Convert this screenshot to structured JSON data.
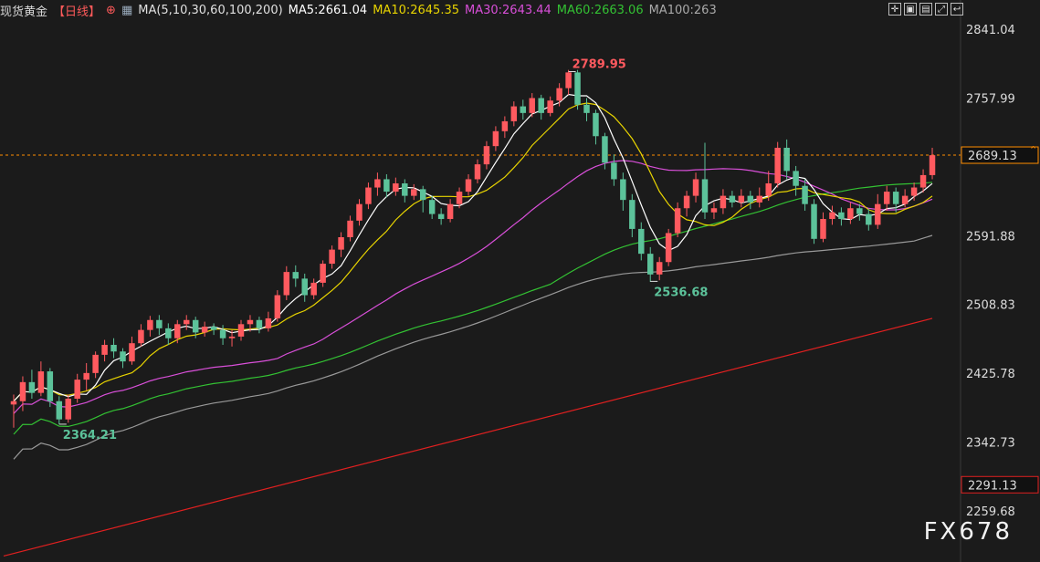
{
  "header": {
    "title": "现货黄金",
    "period": "【日线】",
    "ma_params": "MA(5,10,30,60,100,200)",
    "ma5": "MA5:2661.04",
    "ma10": "MA10:2645.35",
    "ma30": "MA30:2643.44",
    "ma60": "MA60:2663.06",
    "ma100": "MA100:263"
  },
  "watermark": "FX678",
  "colors": {
    "background": "#1b1b1b",
    "up": "#ff5a5f",
    "down": "#5cc29a",
    "ma5": "#ffffff",
    "ma10": "#e8d400",
    "ma30": "#d94fd9",
    "ma60": "#33c233",
    "ma100": "#999999",
    "ma200": "#e02020",
    "price_line": "#ff8c00"
  },
  "chart_data": {
    "type": "candlestick",
    "title": "现货黄金【日线】",
    "y_range": [
      2200,
      2850
    ],
    "y_ticks": [
      2841.04,
      2757.99,
      2591.88,
      2508.83,
      2425.78,
      2342.73,
      2259.68
    ],
    "current_price": "2689.13",
    "ma200_label": "2291.13",
    "annotations": [
      {
        "label": "2789.95",
        "value": 2789.95,
        "type": "high"
      },
      {
        "label": "2536.68",
        "value": 2536.68,
        "type": "low"
      },
      {
        "label": "2364.21",
        "value": 2364.21,
        "type": "low"
      }
    ],
    "candles": [
      [
        2388,
        2392,
        2360,
        2400
      ],
      [
        2392,
        2415,
        2380,
        2422
      ],
      [
        2415,
        2402,
        2395,
        2430
      ],
      [
        2402,
        2428,
        2398,
        2440
      ],
      [
        2428,
        2392,
        2385,
        2432
      ],
      [
        2392,
        2370,
        2364,
        2398
      ],
      [
        2370,
        2395,
        2366,
        2400
      ],
      [
        2395,
        2418,
        2390,
        2425
      ],
      [
        2418,
        2426,
        2405,
        2438
      ],
      [
        2426,
        2448,
        2420,
        2452
      ],
      [
        2448,
        2460,
        2440,
        2466
      ],
      [
        2460,
        2452,
        2444,
        2468
      ],
      [
        2452,
        2440,
        2432,
        2456
      ],
      [
        2440,
        2462,
        2436,
        2470
      ],
      [
        2462,
        2478,
        2458,
        2485
      ],
      [
        2478,
        2490,
        2470,
        2495
      ],
      [
        2490,
        2480,
        2472,
        2496
      ],
      [
        2480,
        2468,
        2460,
        2486
      ],
      [
        2468,
        2485,
        2462,
        2490
      ],
      [
        2485,
        2490,
        2478,
        2496
      ],
      [
        2490,
        2475,
        2468,
        2494
      ],
      [
        2475,
        2482,
        2470,
        2488
      ],
      [
        2482,
        2478,
        2472,
        2486
      ],
      [
        2478,
        2468,
        2460,
        2484
      ],
      [
        2468,
        2470,
        2458,
        2478
      ],
      [
        2470,
        2485,
        2465,
        2490
      ],
      [
        2485,
        2490,
        2476,
        2496
      ],
      [
        2490,
        2480,
        2474,
        2494
      ],
      [
        2480,
        2492,
        2476,
        2500
      ],
      [
        2492,
        2520,
        2488,
        2526
      ],
      [
        2520,
        2548,
        2514,
        2555
      ],
      [
        2548,
        2540,
        2530,
        2556
      ],
      [
        2540,
        2520,
        2512,
        2546
      ],
      [
        2520,
        2535,
        2515,
        2540
      ],
      [
        2535,
        2558,
        2530,
        2562
      ],
      [
        2558,
        2575,
        2552,
        2580
      ],
      [
        2575,
        2590,
        2566,
        2596
      ],
      [
        2590,
        2610,
        2585,
        2616
      ],
      [
        2610,
        2630,
        2604,
        2636
      ],
      [
        2630,
        2650,
        2624,
        2656
      ],
      [
        2650,
        2660,
        2640,
        2668
      ],
      [
        2660,
        2645,
        2638,
        2666
      ],
      [
        2645,
        2655,
        2640,
        2662
      ],
      [
        2655,
        2640,
        2632,
        2660
      ],
      [
        2640,
        2648,
        2635,
        2654
      ],
      [
        2648,
        2635,
        2620,
        2652
      ],
      [
        2635,
        2618,
        2612,
        2640
      ],
      [
        2618,
        2612,
        2605,
        2625
      ],
      [
        2612,
        2630,
        2608,
        2636
      ],
      [
        2630,
        2645,
        2625,
        2650
      ],
      [
        2645,
        2660,
        2640,
        2666
      ],
      [
        2660,
        2678,
        2655,
        2684
      ],
      [
        2678,
        2700,
        2672,
        2706
      ],
      [
        2700,
        2718,
        2694,
        2724
      ],
      [
        2718,
        2730,
        2710,
        2736
      ],
      [
        2730,
        2748,
        2724,
        2754
      ],
      [
        2748,
        2740,
        2732,
        2756
      ],
      [
        2740,
        2758,
        2735,
        2764
      ],
      [
        2758,
        2740,
        2732,
        2762
      ],
      [
        2740,
        2755,
        2736,
        2760
      ],
      [
        2755,
        2770,
        2748,
        2776
      ],
      [
        2770,
        2789,
        2762,
        2792
      ],
      [
        2789,
        2750,
        2744,
        2792
      ],
      [
        2750,
        2740,
        2730,
        2758
      ],
      [
        2740,
        2712,
        2702,
        2744
      ],
      [
        2712,
        2680,
        2672,
        2716
      ],
      [
        2680,
        2660,
        2652,
        2690
      ],
      [
        2660,
        2635,
        2622,
        2668
      ],
      [
        2635,
        2600,
        2590,
        2642
      ],
      [
        2600,
        2570,
        2562,
        2608
      ],
      [
        2570,
        2545,
        2536,
        2578
      ],
      [
        2545,
        2560,
        2538,
        2566
      ],
      [
        2560,
        2595,
        2555,
        2600
      ],
      [
        2595,
        2625,
        2590,
        2632
      ],
      [
        2625,
        2640,
        2615,
        2646
      ],
      [
        2640,
        2660,
        2632,
        2668
      ],
      [
        2660,
        2620,
        2612,
        2704
      ],
      [
        2620,
        2625,
        2612,
        2632
      ],
      [
        2625,
        2640,
        2618,
        2648
      ],
      [
        2640,
        2632,
        2626,
        2646
      ],
      [
        2632,
        2640,
        2626,
        2648
      ],
      [
        2640,
        2632,
        2624,
        2646
      ],
      [
        2632,
        2640,
        2626,
        2650
      ],
      [
        2640,
        2655,
        2634,
        2670
      ],
      [
        2655,
        2698,
        2650,
        2705
      ],
      [
        2698,
        2670,
        2660,
        2708
      ],
      [
        2670,
        2652,
        2640,
        2676
      ],
      [
        2652,
        2630,
        2622,
        2660
      ],
      [
        2630,
        2588,
        2582,
        2636
      ],
      [
        2588,
        2612,
        2584,
        2620
      ],
      [
        2612,
        2620,
        2605,
        2628
      ],
      [
        2620,
        2612,
        2604,
        2626
      ],
      [
        2612,
        2625,
        2606,
        2632
      ],
      [
        2625,
        2618,
        2610,
        2630
      ],
      [
        2618,
        2605,
        2598,
        2624
      ],
      [
        2605,
        2630,
        2600,
        2642
      ],
      [
        2630,
        2645,
        2622,
        2652
      ],
      [
        2645,
        2630,
        2620,
        2650
      ],
      [
        2630,
        2640,
        2626,
        2648
      ],
      [
        2640,
        2650,
        2634,
        2656
      ],
      [
        2650,
        2665,
        2644,
        2672
      ],
      [
        2665,
        2689,
        2660,
        2698
      ]
    ]
  }
}
